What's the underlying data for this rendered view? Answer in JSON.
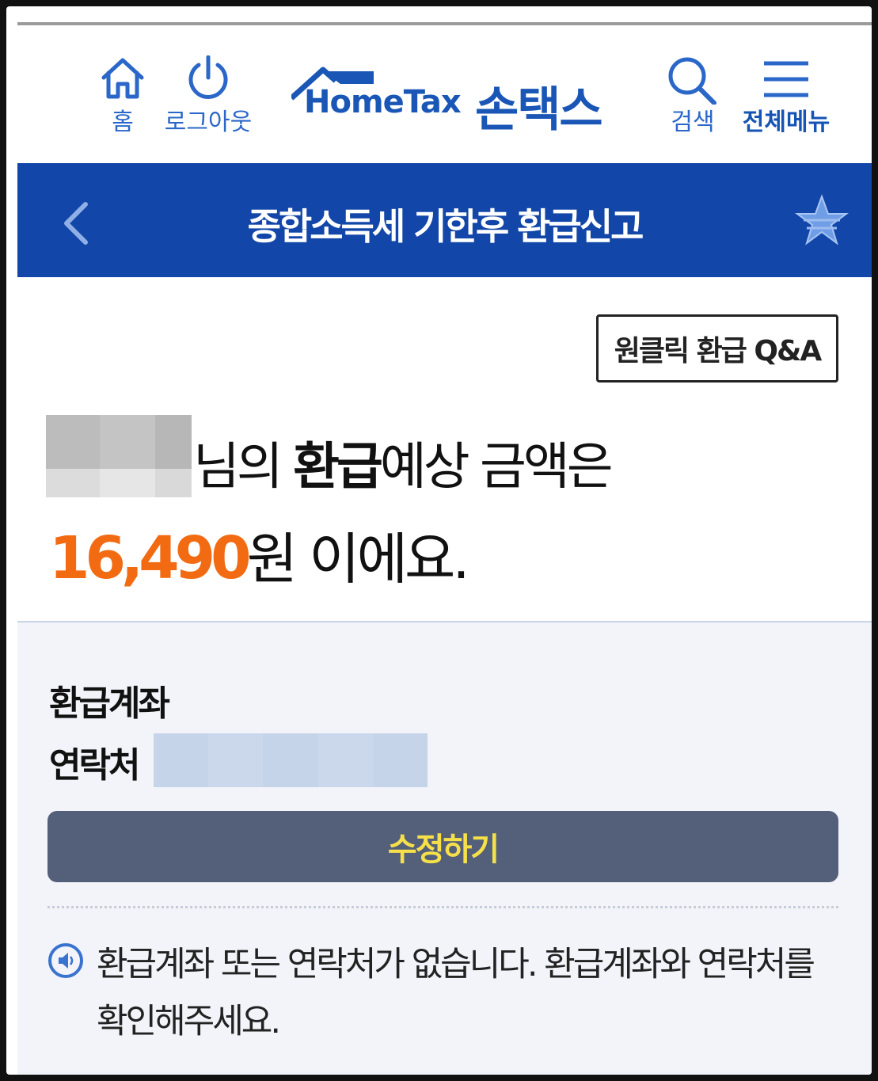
{
  "header": {
    "home_label": "홈",
    "logout_label": "로그아웃",
    "logo_text": "HomeTax",
    "logo_korean": "손택스",
    "search_label": "검색",
    "menu_label": "전체메뉴"
  },
  "titlebar": {
    "title": "종합소득세 기한후 환급신고"
  },
  "main": {
    "qa_button": "원클릭 환급 Q&A",
    "line1_suffix": "님의 ",
    "line1_bold": "환급",
    "line1_rest": "예상 금액은",
    "amount": "16,490",
    "line2_rest": "원 이에요."
  },
  "lower": {
    "account_label": "환급계좌",
    "contact_label": "연락처",
    "edit_button": "수정하기",
    "notice": "환급계좌 또는 연락처가 없습니다. 환급계좌와 연락처를 확인해주세요."
  },
  "colors": {
    "brand_blue": "#1246a8",
    "amount_orange": "#f26a12",
    "button_text_yellow": "#f6e04a"
  }
}
